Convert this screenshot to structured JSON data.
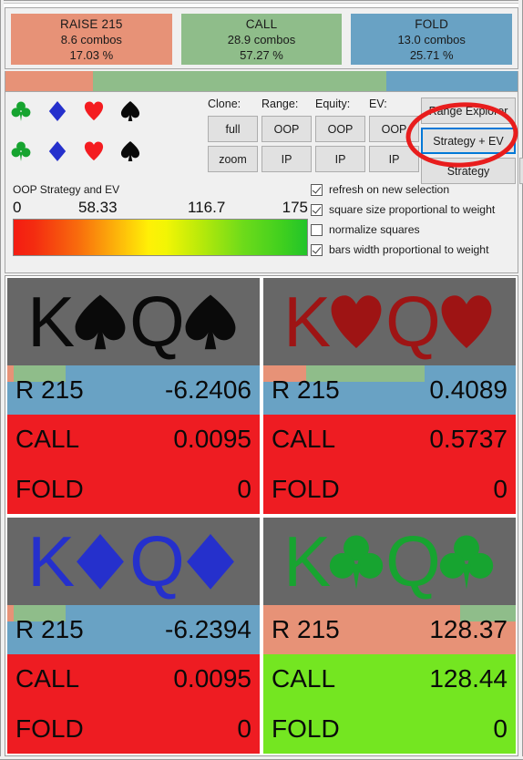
{
  "summary": {
    "actions": [
      {
        "name": "RAISE 215",
        "combos": "8.6 combos",
        "pct": "17.03 %",
        "color": "#e79277",
        "weight": 17.03
      },
      {
        "name": "CALL",
        "combos": "28.9 combos",
        "pct": "57.27 %",
        "color": "#8fbd8a",
        "weight": 57.27
      },
      {
        "name": "FOLD",
        "combos": "13.0 combos",
        "pct": "25.71 %",
        "color": "#69a2c4",
        "weight": 25.71
      }
    ]
  },
  "suits": {
    "row1": [
      "club-icon",
      "diamond-icon",
      "heart-icon",
      "spade-icon"
    ],
    "row2": [
      "club-icon",
      "diamond-icon",
      "heart-icon",
      "spade-icon"
    ]
  },
  "controls": {
    "column_labels": {
      "clone": "Clone:",
      "range": "Range:",
      "equity": "Equity:",
      "ev": "EV:"
    },
    "buttons": {
      "clone_full": "full",
      "clone_zoom": "zoom",
      "range_oop": "OOP",
      "range_ip": "IP",
      "equity_oop": "OOP",
      "equity_ip": "IP",
      "ev_oop": "OOP",
      "ev_ip": "IP",
      "range_explorer": "Range Explorer",
      "strategy_ev": "Strategy + EV",
      "strategy": "Strategy",
      "collapse": "<"
    }
  },
  "checkboxes": [
    {
      "label": "refresh on new selection",
      "checked": true
    },
    {
      "label": "square size proportional to weight",
      "checked": true
    },
    {
      "label": "normalize squares",
      "checked": false
    },
    {
      "label": "bars width proportional to weight",
      "checked": true
    }
  ],
  "ev_scale": {
    "title": "OOP Strategy and EV",
    "ticks": [
      "0",
      "58.33",
      "116.7",
      "175"
    ],
    "min": 0,
    "max": 175
  },
  "hands": [
    {
      "rank1": "K",
      "rank2": "Q",
      "suit": "spade-icon",
      "suit_color": "#0a0a0a",
      "strategy_bar": [
        {
          "action": "RAISE 215",
          "color": "#e79277",
          "pct": 2.5
        },
        {
          "action": "CALL",
          "color": "#8fbd8a",
          "pct": 20.5
        },
        {
          "action": "FOLD",
          "color": "#69a2c4",
          "pct": 77.0
        }
      ],
      "rows": [
        {
          "name": "R 215",
          "value": "-6.2406",
          "color": "#69a2c4"
        },
        {
          "name": "CALL",
          "value": "0.0095",
          "color": "#ee1c22"
        },
        {
          "name": "FOLD",
          "value": "0",
          "color": "#ee1c22"
        }
      ]
    },
    {
      "rank1": "K",
      "rank2": "Q",
      "suit": "heart-icon",
      "suit_color": "#9e1414",
      "strategy_bar": [
        {
          "action": "RAISE 215",
          "color": "#e79277",
          "pct": 17.0
        },
        {
          "action": "CALL",
          "color": "#8fbd8a",
          "pct": 47.0
        },
        {
          "action": "FOLD",
          "color": "#69a2c4",
          "pct": 36.0
        }
      ],
      "rows": [
        {
          "name": "R 215",
          "value": "0.4089",
          "color": "#69a2c4"
        },
        {
          "name": "CALL",
          "value": "0.5737",
          "color": "#ee1c22"
        },
        {
          "name": "FOLD",
          "value": "0",
          "color": "#ee1c22"
        }
      ]
    },
    {
      "rank1": "K",
      "rank2": "Q",
      "suit": "diamond-icon",
      "suit_color": "#2530cc",
      "strategy_bar": [
        {
          "action": "RAISE 215",
          "color": "#e79277",
          "pct": 2.5
        },
        {
          "action": "CALL",
          "color": "#8fbd8a",
          "pct": 20.5
        },
        {
          "action": "FOLD",
          "color": "#69a2c4",
          "pct": 77.0
        }
      ],
      "rows": [
        {
          "name": "R 215",
          "value": "-6.2394",
          "color": "#69a2c4"
        },
        {
          "name": "CALL",
          "value": "0.0095",
          "color": "#ee1c22"
        },
        {
          "name": "FOLD",
          "value": "0",
          "color": "#ee1c22"
        }
      ]
    },
    {
      "rank1": "K",
      "rank2": "Q",
      "suit": "club-icon",
      "suit_color": "#17a430",
      "strategy_bar": [
        {
          "action": "RAISE 215",
          "color": "#e79277",
          "pct": 78.0
        },
        {
          "action": "CALL",
          "color": "#8fbd8a",
          "pct": 22.0
        }
      ],
      "rows": [
        {
          "name": "R 215",
          "value": "128.37",
          "color": "#e79277"
        },
        {
          "name": "CALL",
          "value": "128.44",
          "color": "#74e621"
        },
        {
          "name": "FOLD",
          "value": "0",
          "color": "#74e621"
        }
      ]
    }
  ],
  "annotation": {
    "shape": "ellipse",
    "color": "#e81d1d",
    "targets": "Strategy + EV"
  }
}
